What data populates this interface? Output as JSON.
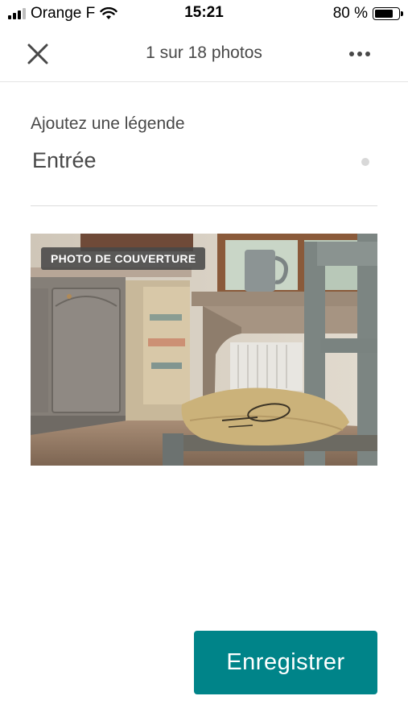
{
  "status_bar": {
    "carrier": "Orange F",
    "time": "15:21",
    "battery_percent": "80 %",
    "battery_level": 0.8
  },
  "header": {
    "title": "1 sur 18 photos",
    "close_icon": "close-icon",
    "more_icon": "more-horizontal-icon"
  },
  "caption": {
    "label": "Ajoutez une légende",
    "value": "Entrée"
  },
  "photo": {
    "badge": "PHOTO DE COUVERTURE"
  },
  "footer": {
    "save_label": "Enregistrer",
    "accent_color": "#008489"
  }
}
